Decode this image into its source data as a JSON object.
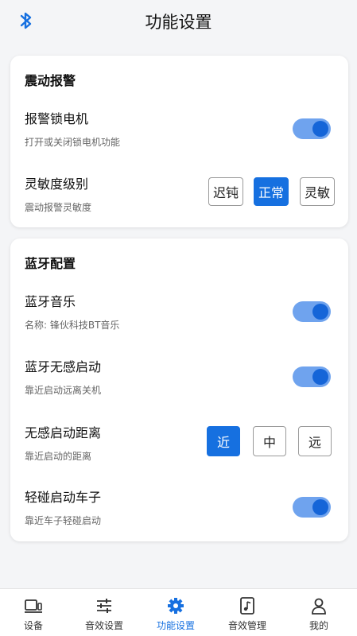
{
  "header": {
    "title": "功能设置",
    "icon": "bluetooth-icon"
  },
  "cards": {
    "vibration": {
      "title": "震动报警",
      "lock_motor": {
        "label": "报警锁电机",
        "sub": "打开或关闭锁电机功能",
        "on": true
      },
      "sensitivity": {
        "label": "灵敏度级别",
        "sub": "震动报警灵敏度",
        "options": [
          "迟钝",
          "正常",
          "灵敏"
        ],
        "selected": "正常"
      }
    },
    "bluetooth": {
      "title": "蓝牙配置",
      "music": {
        "label": "蓝牙音乐",
        "sub": "名称: 锋伙科技BT音乐",
        "on": true
      },
      "keyless": {
        "label": "蓝牙无感启动",
        "sub": "靠近启动远离关机",
        "on": true
      },
      "distance": {
        "label": "无感启动距离",
        "sub": "靠近启动的距离",
        "options": [
          "近",
          "中",
          "远"
        ],
        "selected": "近"
      },
      "tap_start": {
        "label": "轻碰启动车子",
        "sub": "靠近车子轻碰启动",
        "on": true
      }
    }
  },
  "tabs": [
    {
      "label": "设备",
      "icon": "device-icon"
    },
    {
      "label": "音效设置",
      "icon": "sliders-icon"
    },
    {
      "label": "功能设置",
      "icon": "gear-icon",
      "active": true
    },
    {
      "label": "音效管理",
      "icon": "music-file-icon"
    },
    {
      "label": "我的",
      "icon": "user-icon"
    }
  ],
  "colors": {
    "accent": "#1670e0",
    "toggle_track": "#6fa3ee",
    "background": "#f4f5f7"
  }
}
